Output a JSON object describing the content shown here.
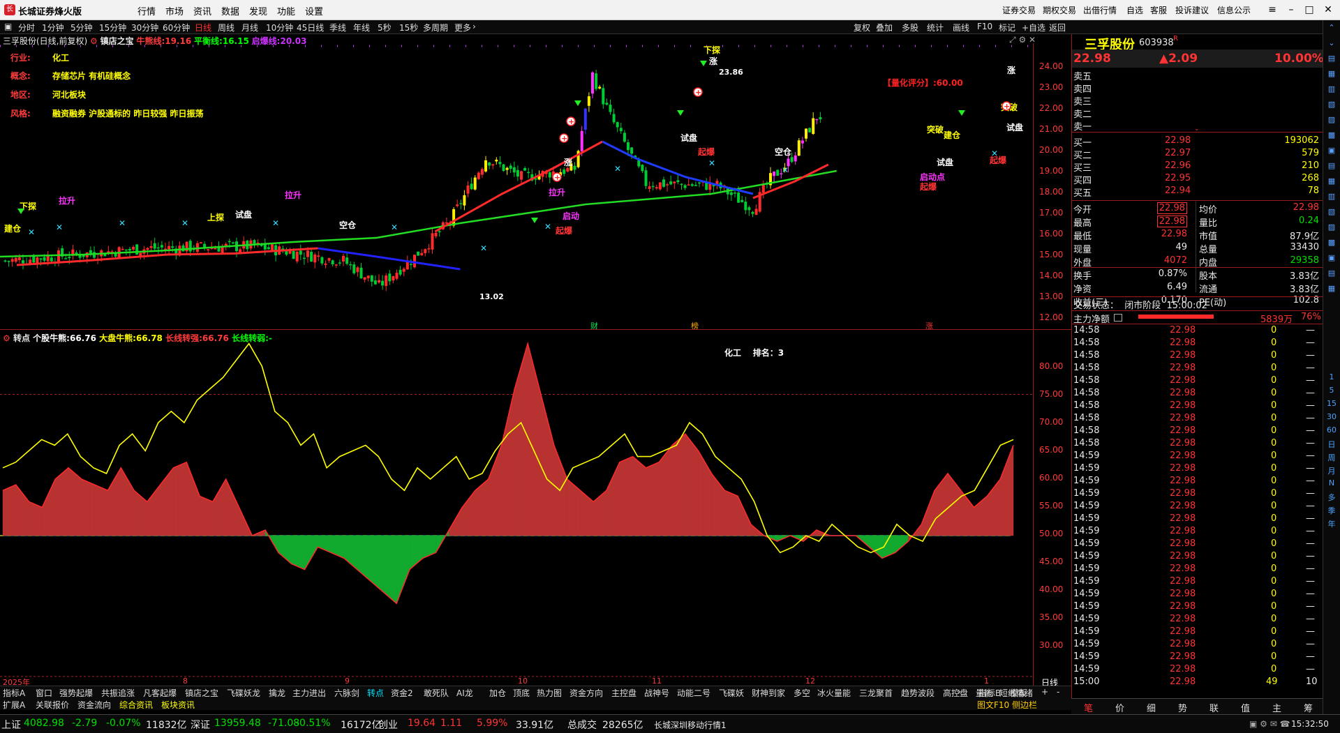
{
  "app": {
    "title": "长城证券烽火版",
    "logo": "长"
  },
  "menu": [
    "行情",
    "市场",
    "资讯",
    "数据",
    "发现",
    "功能",
    "设置"
  ],
  "right_menu": [
    "证券交易",
    "期权交易",
    "出借行情",
    "自选",
    "客服",
    "投诉建议",
    "信息公示"
  ],
  "toolbar": {
    "periods": [
      "分时",
      "1分钟",
      "5分钟",
      "15分钟",
      "30分钟",
      "60分钟",
      "日线",
      "周线",
      "月线",
      "10分钟",
      "45日线",
      "季线",
      "年线",
      "5秒",
      "15秒",
      "多周期",
      "更多"
    ],
    "active_period": "日线",
    "right": [
      "复权",
      "叠加",
      "多股",
      "统计",
      "画线",
      "F10",
      "标记",
      "+自选",
      "返回"
    ]
  },
  "chart_header": {
    "name": "三孚股份(日线,前复权)",
    "indicator": "镇店之宝",
    "items": [
      {
        "label": "牛熊线:",
        "value": "19.16",
        "color": "#ff3b3b"
      },
      {
        "label": "平衡线:",
        "value": "16.15",
        "color": "#00ff00"
      },
      {
        "label": "启爆线:",
        "value": "20.03",
        "color": "#cc33ff"
      }
    ]
  },
  "stock_info": [
    {
      "label": "行业:",
      "value": "化工"
    },
    {
      "label": "概念:",
      "value": "存储芯片 有机硅概念"
    },
    {
      "label": "地区:",
      "value": "河北板块"
    },
    {
      "label": "风格:",
      "value": "融资融券 沪股通标的 昨日较强 昨日振荡"
    }
  ],
  "price_axis": [
    "24.00",
    "23.00",
    "22.00",
    "21.00",
    "20.00",
    "19.00",
    "18.00",
    "17.00",
    "16.00",
    "15.00",
    "14.00",
    "13.00",
    "12.00"
  ],
  "price_annotations": {
    "high": "23.86",
    "low": "13.02",
    "score": "【量化评分】:60.00",
    "signals": [
      "下探",
      "拉升",
      "建仓",
      "试盘",
      "空仓",
      "起爆",
      "启动点",
      "上探",
      "突破",
      "涨",
      "脚"
    ]
  },
  "ind_header": {
    "name": "转点",
    "items": [
      {
        "label": "个股牛熊:",
        "value": "66.76",
        "color": "#ffffff"
      },
      {
        "label": "大盘牛熊:",
        "value": "66.78",
        "color": "#ffff00"
      },
      {
        "label": "长线转强:",
        "value": "66.76",
        "color": "#ff3b3b"
      },
      {
        "label": "长线转弱:",
        "value": "-",
        "color": "#00ff00"
      }
    ],
    "rank_label": "化工    排名：3"
  },
  "ind_axis": [
    "80.00",
    "75.00",
    "70.00",
    "65.00",
    "60.00",
    "55.00",
    "50.00",
    "45.00",
    "40.00",
    "35.00",
    "30.00"
  ],
  "time_axis": [
    "2025年",
    "8",
    "9",
    "10",
    "11",
    "12",
    "1",
    "日线"
  ],
  "quote": {
    "name": "三孚股份",
    "code": "603938",
    "flag": "R",
    "price": "22.98",
    "change": "▲2.09",
    "pct": "10.00%",
    "asks": [
      {
        "label": "卖五",
        "price": "",
        "vol": ""
      },
      {
        "label": "卖四",
        "price": "",
        "vol": ""
      },
      {
        "label": "卖三",
        "price": "",
        "vol": ""
      },
      {
        "label": "卖二",
        "price": "",
        "vol": ""
      },
      {
        "label": "卖一",
        "price": "",
        "vol": ""
      }
    ],
    "bids": [
      {
        "label": "买一",
        "price": "22.98",
        "vol": "193062"
      },
      {
        "label": "买二",
        "price": "22.97",
        "vol": "579"
      },
      {
        "label": "买三",
        "price": "22.96",
        "vol": "210"
      },
      {
        "label": "买四",
        "price": "22.95",
        "vol": "268"
      },
      {
        "label": "买五",
        "price": "22.94",
        "vol": "78"
      }
    ],
    "stats": [
      {
        "l1": "今开",
        "v1": "22.98",
        "c1": "red",
        "l2": "均价",
        "v2": "22.98",
        "c2": "red"
      },
      {
        "l1": "最高",
        "v1": "22.98",
        "c1": "red",
        "l2": "量比",
        "v2": "0.24",
        "c2": "green"
      },
      {
        "l1": "最低",
        "v1": "22.98",
        "c1": "red",
        "l2": "市值",
        "v2": "87.9亿",
        "c2": "white"
      },
      {
        "l1": "现量",
        "v1": "49",
        "c1": "white",
        "l2": "总量",
        "v2": "33430",
        "c2": "white"
      },
      {
        "l1": "外盘",
        "v1": "4072",
        "c1": "red",
        "l2": "内盘",
        "v2": "29358",
        "c2": "green"
      },
      {
        "l1": "换手",
        "v1": "0.87%",
        "c1": "white",
        "l2": "股本",
        "v2": "3.83亿",
        "c2": "white"
      },
      {
        "l1": "净资",
        "v1": "6.49",
        "c1": "white",
        "l2": "流通",
        "v2": "3.83亿",
        "c2": "white"
      },
      {
        "l1": "收益(三)",
        "v1": "0.170",
        "c1": "white",
        "l2": "PE(动)",
        "v2": "102.8",
        "c2": "white"
      }
    ],
    "trade_status": "交易状态：  闭市阶段  15:00:02",
    "main_net_label": "主力净额",
    "main_net_value": "5839万",
    "main_net_pct": "76%"
  },
  "ticks": [
    [
      "14:58",
      "22.98",
      "0",
      "—"
    ],
    [
      "14:58",
      "22.98",
      "0",
      "—"
    ],
    [
      "14:58",
      "22.98",
      "0",
      "—"
    ],
    [
      "14:58",
      "22.98",
      "0",
      "—"
    ],
    [
      "14:58",
      "22.98",
      "0",
      "—"
    ],
    [
      "14:58",
      "22.98",
      "0",
      "—"
    ],
    [
      "14:58",
      "22.98",
      "0",
      "—"
    ],
    [
      "14:58",
      "22.98",
      "0",
      "—"
    ],
    [
      "14:58",
      "22.98",
      "0",
      "—"
    ],
    [
      "14:58",
      "22.98",
      "0",
      "—"
    ],
    [
      "14:59",
      "22.98",
      "0",
      "—"
    ],
    [
      "14:59",
      "22.98",
      "0",
      "—"
    ],
    [
      "14:59",
      "22.98",
      "0",
      "—"
    ],
    [
      "14:59",
      "22.98",
      "0",
      "—"
    ],
    [
      "14:59",
      "22.98",
      "0",
      "—"
    ],
    [
      "14:59",
      "22.98",
      "0",
      "—"
    ],
    [
      "14:59",
      "22.98",
      "0",
      "—"
    ],
    [
      "14:59",
      "22.98",
      "0",
      "—"
    ],
    [
      "14:59",
      "22.98",
      "0",
      "—"
    ],
    [
      "14:59",
      "22.98",
      "0",
      "—"
    ],
    [
      "14:59",
      "22.98",
      "0",
      "—"
    ],
    [
      "14:59",
      "22.98",
      "0",
      "—"
    ],
    [
      "14:59",
      "22.98",
      "0",
      "—"
    ],
    [
      "14:59",
      "22.98",
      "0",
      "—"
    ],
    [
      "14:59",
      "22.98",
      "0",
      "—"
    ],
    [
      "14:59",
      "22.98",
      "0",
      "—"
    ],
    [
      "14:59",
      "22.98",
      "0",
      "—"
    ],
    [
      "14:59",
      "22.98",
      "0",
      "—"
    ],
    [
      "15:00",
      "22.98",
      "49",
      "10"
    ]
  ],
  "tabs_row1": [
    "指标A",
    "窗口",
    "强势起爆",
    "共振追涨",
    "凡客起爆",
    "镇店之宝",
    "飞碟妖龙",
    "擒龙",
    "主力进出",
    "六脉剑",
    "转点",
    "资金2",
    "敢死队",
    "AI龙",
    "加仓",
    "顶底",
    "热力图",
    "资金方向",
    "主控盘",
    "战神号",
    "动能二号",
    "飞碟妖",
    "财神到家",
    "多空",
    "冰火量能",
    "三龙聚首",
    "趋势波段",
    "高控盘",
    "量能",
    "短线情绪"
  ],
  "tabs_row1_right": [
    "指标B",
    "模板"
  ],
  "active_tab": "转点",
  "tabs_row2": [
    "扩展A",
    "关联报价",
    "资金流向",
    "综合资讯",
    "板块资讯"
  ],
  "tabs_row2_right": "图文F10 侧边栏",
  "right_tabs": [
    "笔",
    "价",
    "细",
    "势",
    "联",
    "值",
    "主",
    "筹"
  ],
  "status_bar": [
    {
      "t": "上证",
      "c": "white"
    },
    {
      "t": "4082.98",
      "c": "green"
    },
    {
      "t": "-2.79",
      "c": "green"
    },
    {
      "t": "-0.07%",
      "c": "green"
    },
    {
      "t": "11832亿",
      "c": "white"
    },
    {
      "t": "深证",
      "c": "white"
    },
    {
      "t": "13959.48",
      "c": "green"
    },
    {
      "t": "-71.08",
      "c": "green"
    },
    {
      "t": "-0.51%",
      "c": "green"
    },
    {
      "t": "16172亿",
      "c": "white"
    },
    {
      "t": "创业",
      "c": "white"
    },
    {
      "t": "19.64",
      "c": "red"
    },
    {
      "t": "1.11",
      "c": "red"
    },
    {
      "t": "5.99%",
      "c": "red"
    },
    {
      "t": "33.91亿",
      "c": "white"
    },
    {
      "t": "总成交",
      "c": "white"
    },
    {
      "t": "28265亿",
      "c": "white"
    },
    {
      "t": "长城深圳移动行情1",
      "c": "white"
    }
  ],
  "clock": "15:32:50",
  "side_icons": [
    "1",
    "5",
    "15",
    "30",
    "60",
    "日",
    "周",
    "月",
    "N",
    "多",
    "季",
    "年"
  ],
  "chart_data": {
    "type": "line",
    "title": "三孚股份(日线,前复权)",
    "price_lines": {
      "axis": [
        12,
        24.5
      ],
      "balance_line": [
        [
          0,
          14.8
        ],
        [
          0.1,
          14.9
        ],
        [
          0.2,
          15.1
        ],
        [
          0.35,
          15.5
        ],
        [
          0.45,
          15.7
        ],
        [
          0.55,
          16.4
        ],
        [
          0.7,
          17.3
        ],
        [
          0.85,
          17.8
        ],
        [
          1,
          18.9
        ]
      ],
      "bull_bear": [
        [
          0.02,
          14.4
        ],
        [
          0.1,
          14.6
        ],
        [
          0.2,
          14.9
        ],
        [
          0.28,
          14.95
        ],
        [
          0.38,
          15.2
        ]
      ],
      "red_line_2": [
        [
          0.52,
          16.0
        ],
        [
          0.6,
          17.8
        ],
        [
          0.66,
          19.0
        ],
        [
          0.72,
          20.3
        ]
      ]
    },
    "indicator": {
      "axis": [
        30,
        85
      ],
      "yellow": [
        62,
        63,
        65,
        67,
        66,
        68,
        64,
        62,
        61,
        66,
        68,
        65,
        70,
        72,
        70,
        74,
        76,
        78,
        81,
        84,
        80,
        72,
        70,
        66,
        68,
        62,
        64,
        65,
        66,
        64,
        60,
        58,
        62,
        60,
        62,
        64,
        60,
        61,
        65,
        68,
        70,
        65,
        60,
        58,
        62,
        63,
        64,
        66,
        68,
        64,
        64,
        65,
        66,
        70,
        68,
        64,
        62,
        60,
        56,
        50,
        47,
        48,
        50,
        49,
        52,
        50,
        48,
        47,
        48,
        52,
        50,
        49,
        53,
        55,
        57,
        58,
        62,
        66,
        67
      ],
      "area": [
        58,
        59,
        56,
        55,
        60,
        62,
        60,
        59,
        58,
        62,
        58,
        56,
        59,
        62,
        63,
        57,
        56,
        60,
        55,
        50,
        51,
        47,
        45,
        44,
        48,
        47,
        46,
        44,
        42,
        40,
        38,
        44,
        46,
        47,
        51,
        55,
        58,
        60,
        66,
        76,
        84,
        75,
        66,
        60,
        58,
        56,
        58,
        63,
        64,
        62,
        63,
        66,
        68,
        65,
        61,
        58,
        57,
        52,
        50,
        49,
        50,
        49,
        51,
        50,
        50,
        50,
        48,
        46,
        47,
        49,
        52,
        58,
        61,
        58,
        55,
        57,
        60,
        66
      ]
    }
  }
}
